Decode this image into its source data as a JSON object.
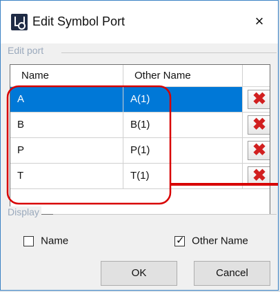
{
  "window": {
    "title": "Edit Symbol Port",
    "close_icon": "×"
  },
  "edit_port": {
    "group_label": "Edit port",
    "columns": {
      "name": "Name",
      "other_name": "Other Name",
      "actions": ""
    },
    "rows": [
      {
        "name": "A",
        "other_name": "A(1)",
        "selected": true
      },
      {
        "name": "B",
        "other_name": "B(1)",
        "selected": false
      },
      {
        "name": "P",
        "other_name": "P(1)",
        "selected": false
      },
      {
        "name": "T",
        "other_name": "T(1)",
        "selected": false
      }
    ]
  },
  "display": {
    "group_label": "Display",
    "name_checkbox": {
      "label": "Name",
      "checked": false
    },
    "other_name_checkbox": {
      "label": "Other Name",
      "checked": true
    }
  },
  "buttons": {
    "ok": "OK",
    "cancel": "Cancel"
  },
  "icons": {
    "app": "symbol-port-app-icon",
    "close": "close-icon",
    "delete": "delete-icon",
    "checkmark": "checkmark-icon"
  },
  "colors": {
    "selection": "#0078d7",
    "delete": "#d11f1f",
    "annotation": "#d80000"
  }
}
